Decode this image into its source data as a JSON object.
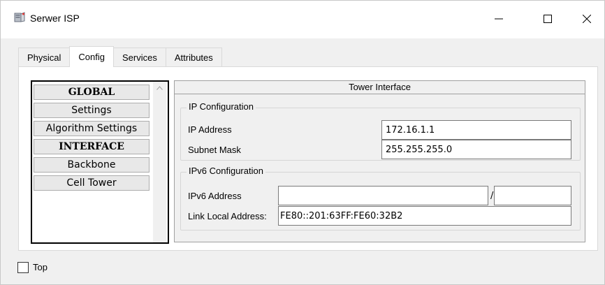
{
  "window": {
    "title": "Serwer ISP",
    "icon": "server-icon",
    "controls": {
      "minimize": "minimize-icon",
      "maximize": "maximize-icon",
      "close": "close-icon"
    }
  },
  "tabs": [
    {
      "label": "Physical",
      "active": false
    },
    {
      "label": "Config",
      "active": true
    },
    {
      "label": "Services",
      "active": false
    },
    {
      "label": "Attributes",
      "active": false
    }
  ],
  "left_list": {
    "items": [
      {
        "label": "GLOBAL",
        "header": true
      },
      {
        "label": "Settings",
        "header": false
      },
      {
        "label": "Algorithm Settings",
        "header": false
      },
      {
        "label": "INTERFACE",
        "header": true
      },
      {
        "label": "Backbone",
        "header": false
      },
      {
        "label": "Cell Tower",
        "header": false
      }
    ]
  },
  "interface_panel": {
    "title": "Tower Interface",
    "ip_config": {
      "title": "IP Configuration",
      "ip_address_label": "IP Address",
      "ip_address_value": "172.16.1.1",
      "subnet_mask_label": "Subnet Mask",
      "subnet_mask_value": "255.255.255.0"
    },
    "ipv6_config": {
      "title": "IPv6 Configuration",
      "ipv6_address_label": "IPv6 Address",
      "ipv6_address_value": "",
      "ipv6_separator": "/",
      "ipv6_prefix_value": "",
      "link_local_label": "Link Local Address:",
      "link_local_value": "FE80::201:63FF:FE60:32B2"
    }
  },
  "footer": {
    "top_checkbox_label": "Top",
    "top_checked": false
  }
}
